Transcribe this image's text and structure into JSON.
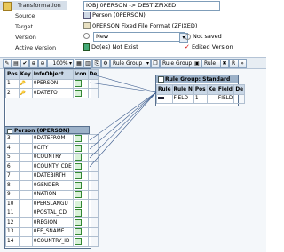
{
  "header": {
    "transformation_label": "Transformation",
    "transformation_value": "IOBJ 0PERSON -> DEST ZFIXED",
    "source_label": "Source",
    "source_value": "Person (0PERSON)",
    "target_label": "Target",
    "target_value": "0PERSON Fixed File Format (ZFIXED)",
    "version_label": "Version",
    "version_value": "New",
    "version_status": "Not saved",
    "active_version_label": "Active Version",
    "active_version_value": "Do(es) Not Exist",
    "edited_version_label": "Edited Version"
  },
  "toolbar": {
    "zoom": "100%",
    "rule_group_1": "Rule Group",
    "rule_group_2": "Rule Group",
    "rule": "Rule",
    "truncated": "R"
  },
  "rule_group_table": {
    "title": "Rule Group: Standard Group",
    "columns": [
      "Rule",
      "Rule N",
      "Pos",
      "Ke",
      "Field",
      "De"
    ],
    "rows": [
      {
        "rule": "",
        "rule_n": "FIELD",
        "pos": "1",
        "ke": "",
        "field": "FIELD",
        "de": ""
      }
    ]
  },
  "source_table": {
    "columns": [
      "Pos",
      "Key",
      "InfoObject",
      "Icon",
      "De"
    ],
    "rows": [
      {
        "pos": "1",
        "key": "🔑",
        "io": "0PERSON"
      },
      {
        "pos": "2",
        "key": "🔑",
        "io": "0DATETO"
      },
      {
        "pos": "3",
        "key": "",
        "io": "0DATEFROM"
      },
      {
        "pos": "4",
        "key": "",
        "io": "0CITY"
      },
      {
        "pos": "5",
        "key": "",
        "io": "0COUNTRY"
      },
      {
        "pos": "6",
        "key": "",
        "io": "0COUNTY_CDE"
      },
      {
        "pos": "7",
        "key": "",
        "io": "0DATEBIRTH"
      },
      {
        "pos": "8",
        "key": "",
        "io": "0GENDER"
      },
      {
        "pos": "9",
        "key": "",
        "io": "0NATION"
      },
      {
        "pos": "10",
        "key": "",
        "io": "0PERSLANGU"
      },
      {
        "pos": "11",
        "key": "",
        "io": "0POSTAL_CD"
      },
      {
        "pos": "12",
        "key": "",
        "io": "0REGION"
      },
      {
        "pos": "13",
        "key": "",
        "io": "0EE_SNAME"
      },
      {
        "pos": "14",
        "key": "",
        "io": "0COUNTRY_ID"
      }
    ],
    "title": "Person (0PERSON)"
  },
  "colors": {
    "link": "#3a5a8c",
    "accent": "#9db2c9"
  }
}
